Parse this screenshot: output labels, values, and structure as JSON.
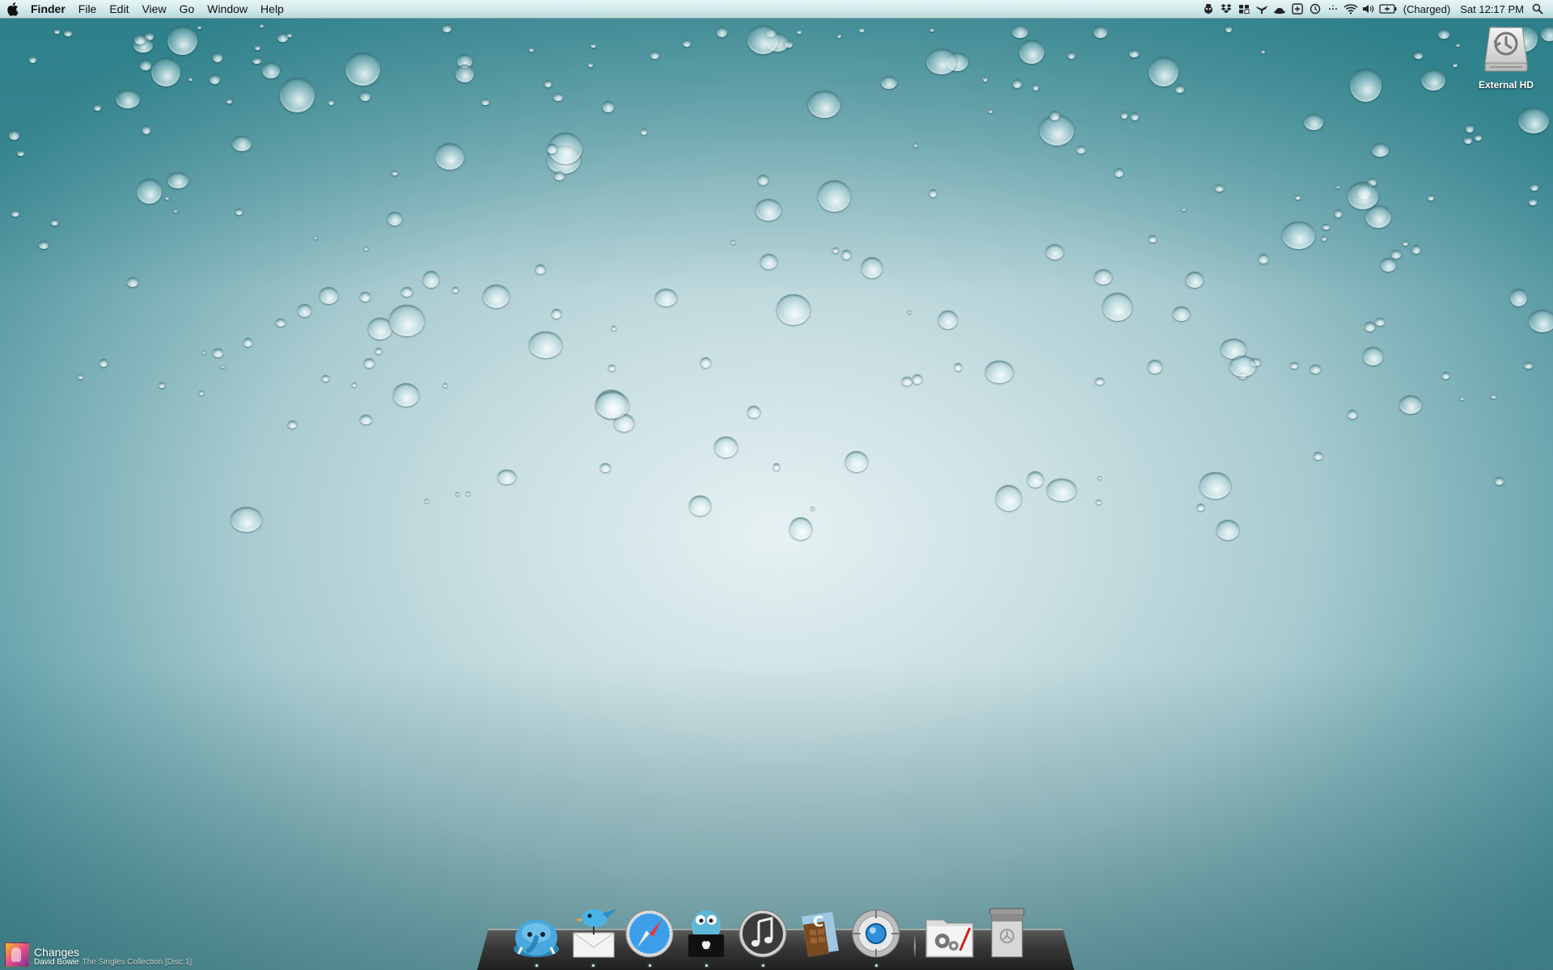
{
  "menubar": {
    "apple_icon": "apple-icon",
    "app_name": "Finder",
    "menus": [
      "File",
      "Edit",
      "View",
      "Go",
      "Window",
      "Help"
    ],
    "status_icons": [
      "adium-icon",
      "dropbox-icon",
      "spaces-icon",
      "tweetie-icon",
      "hat-icon",
      "add-icon",
      "time-machine-icon",
      "menu-extra-icon",
      "wifi-icon",
      "volume-icon",
      "battery-icon"
    ],
    "battery_status": "(Charged)",
    "clock": "Sat 12:17 PM",
    "spotlight_icon": "spotlight-icon"
  },
  "desktop": {
    "icons": [
      {
        "label": "External HD",
        "icon": "time-machine-drive-icon"
      }
    ]
  },
  "dock": {
    "apps": [
      {
        "icon": "elephant-icon",
        "running": true
      },
      {
        "icon": "mail-bird-icon",
        "running": true
      },
      {
        "icon": "safari-icon",
        "running": true
      },
      {
        "icon": "monster-apple-icon",
        "running": true
      },
      {
        "icon": "itunes-icon",
        "running": true
      },
      {
        "icon": "chocolate-icon",
        "running": false
      },
      {
        "icon": "vlc-globe-icon",
        "running": true
      }
    ],
    "stacks": [
      {
        "icon": "applications-folder-icon"
      },
      {
        "icon": "trash-icon"
      }
    ]
  },
  "now_playing": {
    "song": "Changes",
    "artist": "David Bowie",
    "album": "The Singles Collection [Disc 1]"
  },
  "colors": {
    "wallpaper_top": "#3f8a94",
    "wallpaper_center": "#e6f1f2",
    "menubar": "#cfe8ea"
  }
}
